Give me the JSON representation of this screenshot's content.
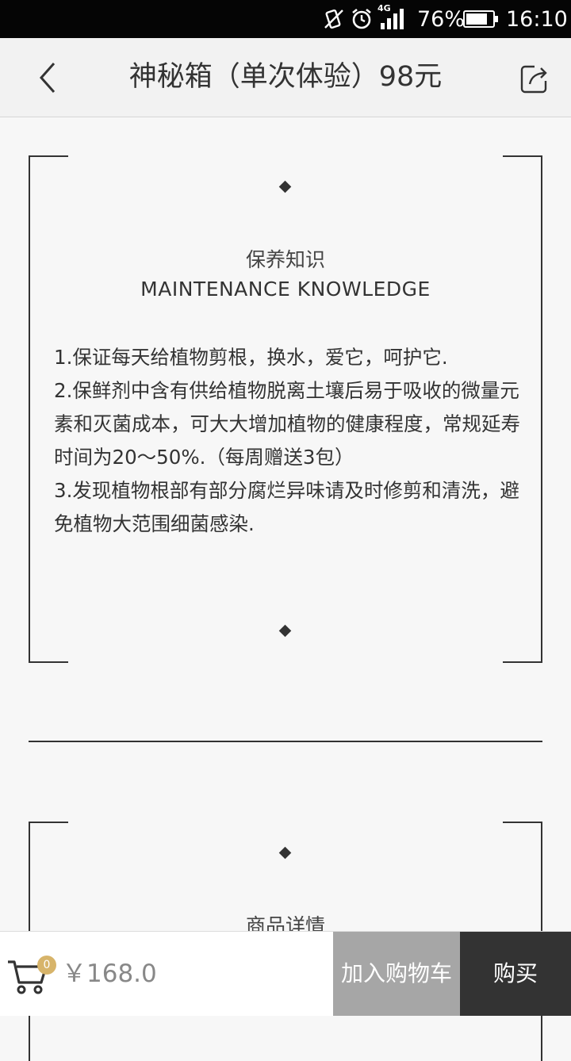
{
  "status_bar": {
    "network": "4G",
    "battery": "76%",
    "time": "16:10"
  },
  "header": {
    "title": "神秘箱（单次体验）98元"
  },
  "maintenance_card": {
    "title_cn": "保养知识",
    "title_en": "MAINTENANCE KNOWLEDGE",
    "items": [
      "1.保证每天给植物剪根，换水，爱它，呵护它.",
      "2.保鲜剂中含有供给植物脱离土壤后易于吸收的微量元素和灭菌成本，可大大增加植物的健康程度，常规延寿时间为20～50%.（每周赠送3包）",
      "3.发现植物根部有部分腐烂异味请及时修剪和清洗，避免植物大范围细菌感染."
    ]
  },
  "details_card": {
    "title_cn": "商品详情"
  },
  "bottom_bar": {
    "cart_count": "0",
    "price": "￥168.0",
    "add_to_cart_label": "加入购物车",
    "buy_label": "购买"
  }
}
